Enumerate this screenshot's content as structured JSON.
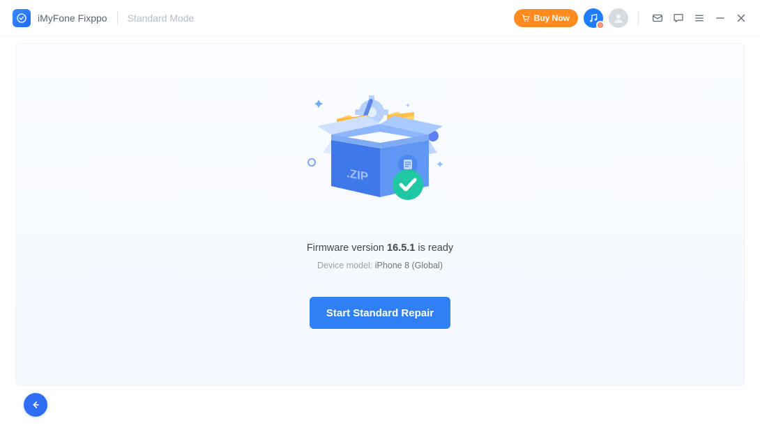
{
  "header": {
    "app_name": "iMyFone Fixppo",
    "mode_label": "Standard Mode",
    "buy_now_label": "Buy Now"
  },
  "main": {
    "firmware_prefix": "Firmware version ",
    "firmware_version": "16.5.1",
    "firmware_suffix": " is ready",
    "device_prefix": "Device model: ",
    "device_model": "iPhone 8 (Global)",
    "start_button_label": "Start Standard Repair",
    "illustration_zip_label": ".ZIP"
  },
  "icons": {
    "app_logo": "fixppo-logo",
    "cart": "cart-icon",
    "music": "music-icon",
    "avatar": "user-icon",
    "mail": "mail-icon",
    "chat": "chat-icon",
    "menu": "menu-icon",
    "minimize": "minimize-icon",
    "close": "close-icon",
    "back": "back-arrow-icon"
  }
}
